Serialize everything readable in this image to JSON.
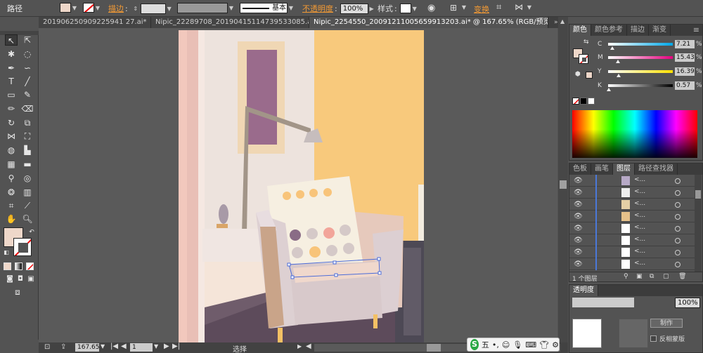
{
  "control_bar": {
    "object_label": "路径",
    "stroke_label": "描边",
    "stroke_style_label": "基本",
    "opacity_label": "不透明度",
    "opacity_value": "100%",
    "style_label": "样式",
    "transform_label": "变换",
    "fill_color": "#eed7c9"
  },
  "tabs": [
    {
      "label": "201906250909225941 27.ai*",
      "close": "×"
    },
    {
      "label": "Nipic_22289708_20190415114739533085.ai*",
      "close": "×"
    },
    {
      "label": "Nipic_2254550_20091211005659913203.ai* @ 167.65% (RGB/预览)",
      "close": "×"
    }
  ],
  "color_panel": {
    "tabs": [
      "颜色",
      "颜色参考",
      "描边",
      "渐变"
    ],
    "channels": [
      {
        "label": "C",
        "value": "7.21",
        "unit": "%",
        "level": 0.07,
        "gradient": "linear-gradient(90deg,#fff,#00a8e8)"
      },
      {
        "label": "M",
        "value": "15.43",
        "unit": "%",
        "level": 0.15,
        "gradient": "linear-gradient(90deg,#fff,#e6007e)"
      },
      {
        "label": "Y",
        "value": "16.39",
        "unit": "%",
        "level": 0.16,
        "gradient": "linear-gradient(90deg,#fff,#ffe100)"
      },
      {
        "label": "K",
        "value": "0.57",
        "unit": "%",
        "level": 0.01,
        "gradient": "linear-gradient(90deg,#fff,#000)"
      }
    ]
  },
  "layers_panel": {
    "tabs": [
      "色板",
      "画笔",
      "图层",
      "路径查找器"
    ],
    "rows": [
      "<...",
      "<...",
      "<...",
      "<...",
      "<...",
      "<...",
      "<...",
      "<..."
    ],
    "footer": "1 个图层"
  },
  "transparency_panel": {
    "title": "透明度",
    "opacity_value": "100%",
    "button_label": "制作",
    "checkbox_label": "反相蒙版"
  },
  "status_bar": {
    "zoom": "167.65",
    "page": "1",
    "tool": "选择"
  },
  "ime": {
    "label": "五"
  }
}
